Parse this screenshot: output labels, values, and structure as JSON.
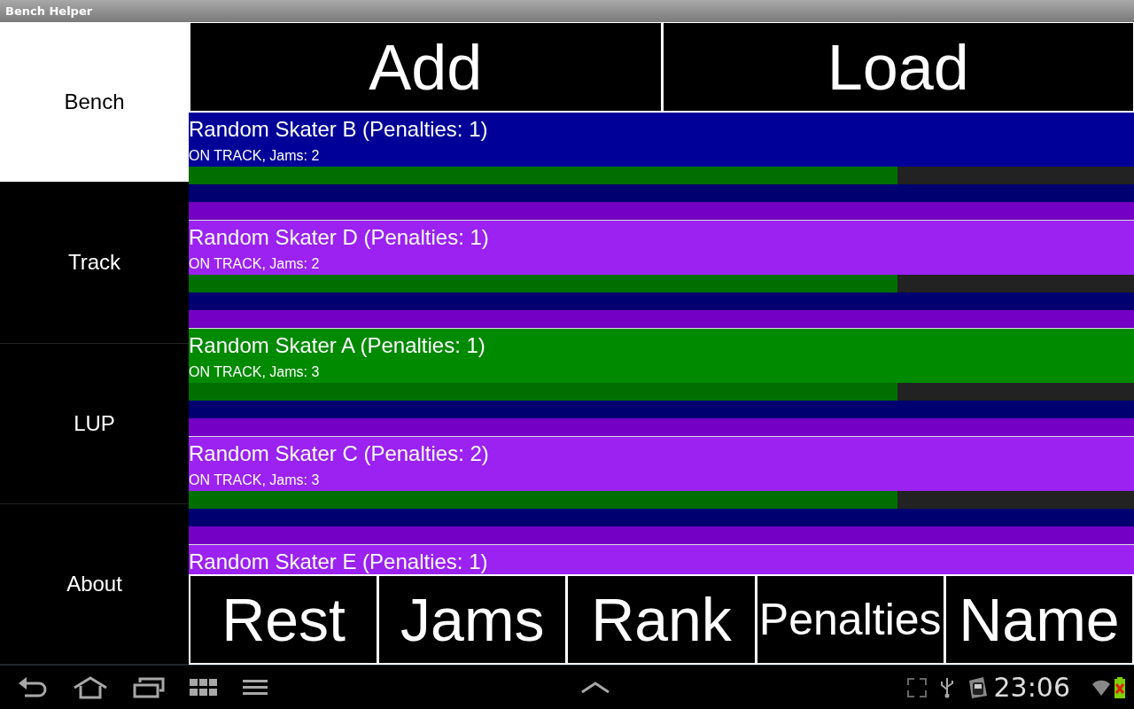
{
  "window": {
    "title": "Bench Helper"
  },
  "sidebar": {
    "items": [
      {
        "label": "Bench",
        "selected": true
      },
      {
        "label": "Track",
        "selected": false
      },
      {
        "label": "LUP",
        "selected": false
      },
      {
        "label": "About",
        "selected": false
      }
    ]
  },
  "top_buttons": [
    "Add",
    "Load"
  ],
  "skaters": [
    {
      "title": "Random Skater B (Penalties: 1)",
      "status": "ON TRACK, Jams: 2",
      "level": 0.75,
      "color": "#000099"
    },
    {
      "title": "Random Skater D (Penalties: 1)",
      "status": "ON TRACK, Jams: 2",
      "level": 0.75,
      "color": "#9b22f0"
    },
    {
      "title": "Random Skater A (Penalties: 1)",
      "status": "ON TRACK, Jams: 3",
      "level": 0.75,
      "color": "#008a00"
    },
    {
      "title": "Random Skater C (Penalties: 2)",
      "status": "ON TRACK, Jams: 3",
      "level": 0.75,
      "color": "#9b22f0"
    },
    {
      "title": "Random Skater E (Penalties: 1)",
      "color": "#9b22f0"
    }
  ],
  "sort_buttons": [
    "Rest",
    "Jams",
    "Rank",
    "Penalties",
    "Name"
  ],
  "status_bar": {
    "time": "23:06"
  }
}
